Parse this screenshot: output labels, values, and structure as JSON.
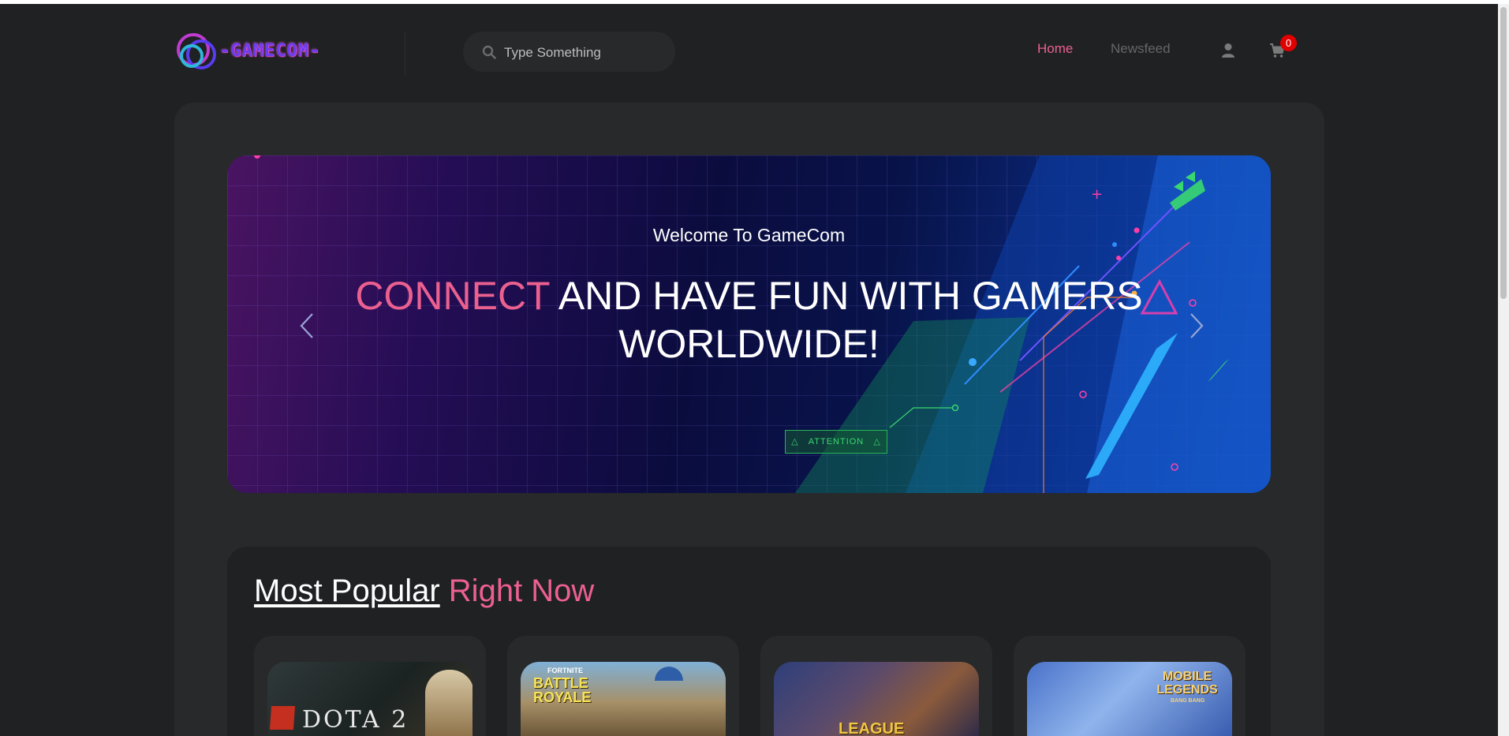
{
  "header": {
    "logo_text": "-GAMECOM-",
    "search_placeholder": "Type Something",
    "nav": [
      {
        "label": "Home",
        "active": true
      },
      {
        "label": "Newsfeed",
        "active": false
      }
    ],
    "cart_count": "0"
  },
  "banner": {
    "welcome": "Welcome To GameCom",
    "heading_accent": "CONNECT",
    "heading_rest": " AND HAVE FUN WITH GAMERS WORLDWIDE!",
    "attention_label": "ATTENTION"
  },
  "popular": {
    "title_part1": "Most Popular",
    "title_part2": "Right Now",
    "games": [
      {
        "name": "DOTA 2",
        "icon": "dota2-cover"
      },
      {
        "name": "BATTLE ROYALE",
        "tag": "FORTNITE",
        "icon": "fortnite-cover"
      },
      {
        "name": "LEAGUE",
        "icon": "league-of-legends-cover"
      },
      {
        "name": "MOBILE LEGENDS",
        "tag": "BANG BANG",
        "icon": "mobile-legends-cover"
      }
    ]
  },
  "colors": {
    "background": "#1f2122",
    "panel": "#27292a",
    "accent": "#ec6090",
    "badge": "#e10000"
  }
}
